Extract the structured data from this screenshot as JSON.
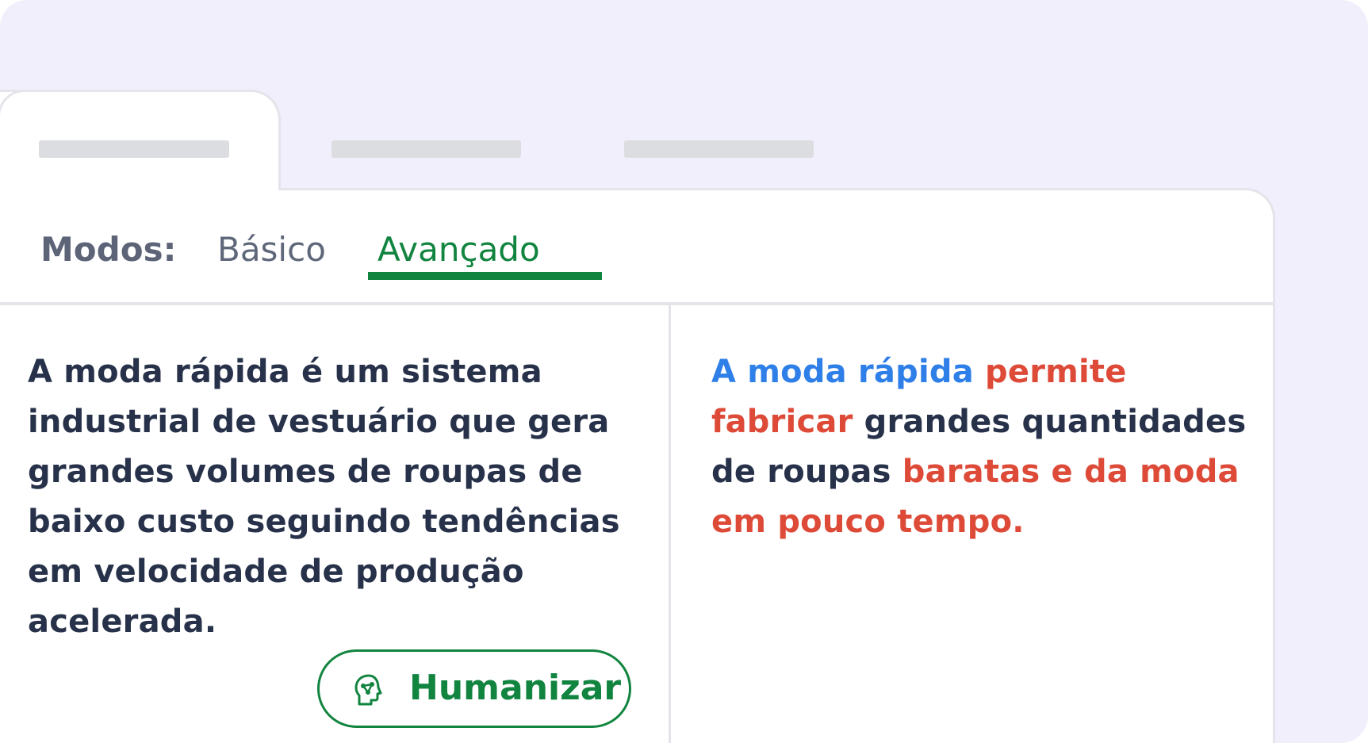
{
  "modes": {
    "label": "Modos:",
    "tabs": [
      {
        "label": "Básico",
        "active": false
      },
      {
        "label": "Avançado",
        "active": true
      }
    ]
  },
  "input_panel": {
    "text": "A moda rápida é um sistema industrial de vestuário que gera grandes volumes de roupas de baixo custo seguindo tendências em velocidade de produção acelerada."
  },
  "output_panel": {
    "segments": [
      {
        "text": "A moda rápida",
        "style": "blue"
      },
      {
        "text": " ",
        "style": "plain"
      },
      {
        "text": "permite fabricar",
        "style": "red"
      },
      {
        "text": " grandes quantidades de roupas ",
        "style": "plain"
      },
      {
        "text": "baratas e da moda em pouco tempo.",
        "style": "red"
      }
    ]
  },
  "humanize_button": {
    "label": "Humanizar",
    "icon": "head-network-icon"
  },
  "colors": {
    "accent_green": "#11843f",
    "highlight_blue": "#2f7fe8",
    "highlight_red": "#de4a38",
    "text_dark": "#27324a",
    "background": "#f2effd"
  }
}
